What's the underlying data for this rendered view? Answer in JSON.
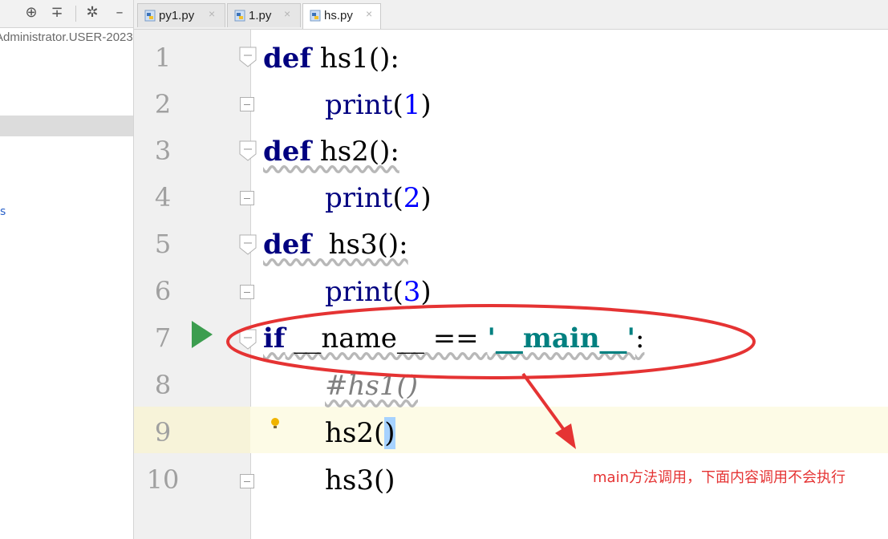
{
  "project_pane": {
    "path_text": "Administrator.USER-2023"
  },
  "tabs": [
    {
      "label": "py1.py",
      "active": false
    },
    {
      "label": "1.py",
      "active": false
    },
    {
      "label": "hs.py",
      "active": true
    }
  ],
  "editor": {
    "line_numbers": [
      "1",
      "2",
      "3",
      "4",
      "5",
      "6",
      "7",
      "8",
      "9",
      "10"
    ],
    "lines": {
      "l1": {
        "kw": "def",
        "rest": " hs1():"
      },
      "l2": {
        "fn": "print",
        "open": "(",
        "num": "1",
        "close": ")"
      },
      "l3": {
        "kw": "def",
        "rest": " hs2():"
      },
      "l4": {
        "fn": "print",
        "open": "(",
        "num": "2",
        "close": ")"
      },
      "l5": {
        "kw": "def",
        "rest": "  hs3():"
      },
      "l6": {
        "fn": "print",
        "open": "(",
        "num": "3",
        "close": ")"
      },
      "l7": {
        "kw": "if",
        "mid": " __name__ == ",
        "str": "'__main__'",
        "end": ":"
      },
      "l8": {
        "comment": "#hs1()"
      },
      "l9": {
        "name": "hs2",
        "open": "(",
        "close": ")"
      },
      "l10": {
        "text": "hs3()"
      }
    }
  },
  "annotation": {
    "text": "main方法调用，下面内容调用不会执行",
    "color": "#e53333"
  },
  "colors": {
    "keyword": "#000080",
    "number": "#0000ff",
    "string": "#008080",
    "comment": "#808080",
    "run": "#3c9d4f",
    "caret_row": "#fdfbe6"
  },
  "icons": {
    "toolbar": [
      "crosshair-icon",
      "collapse-icon",
      "gear-icon",
      "minimize-icon"
    ],
    "tab": "python-file-icon",
    "gutter": [
      "run-icon",
      "lightbulb-icon"
    ]
  }
}
